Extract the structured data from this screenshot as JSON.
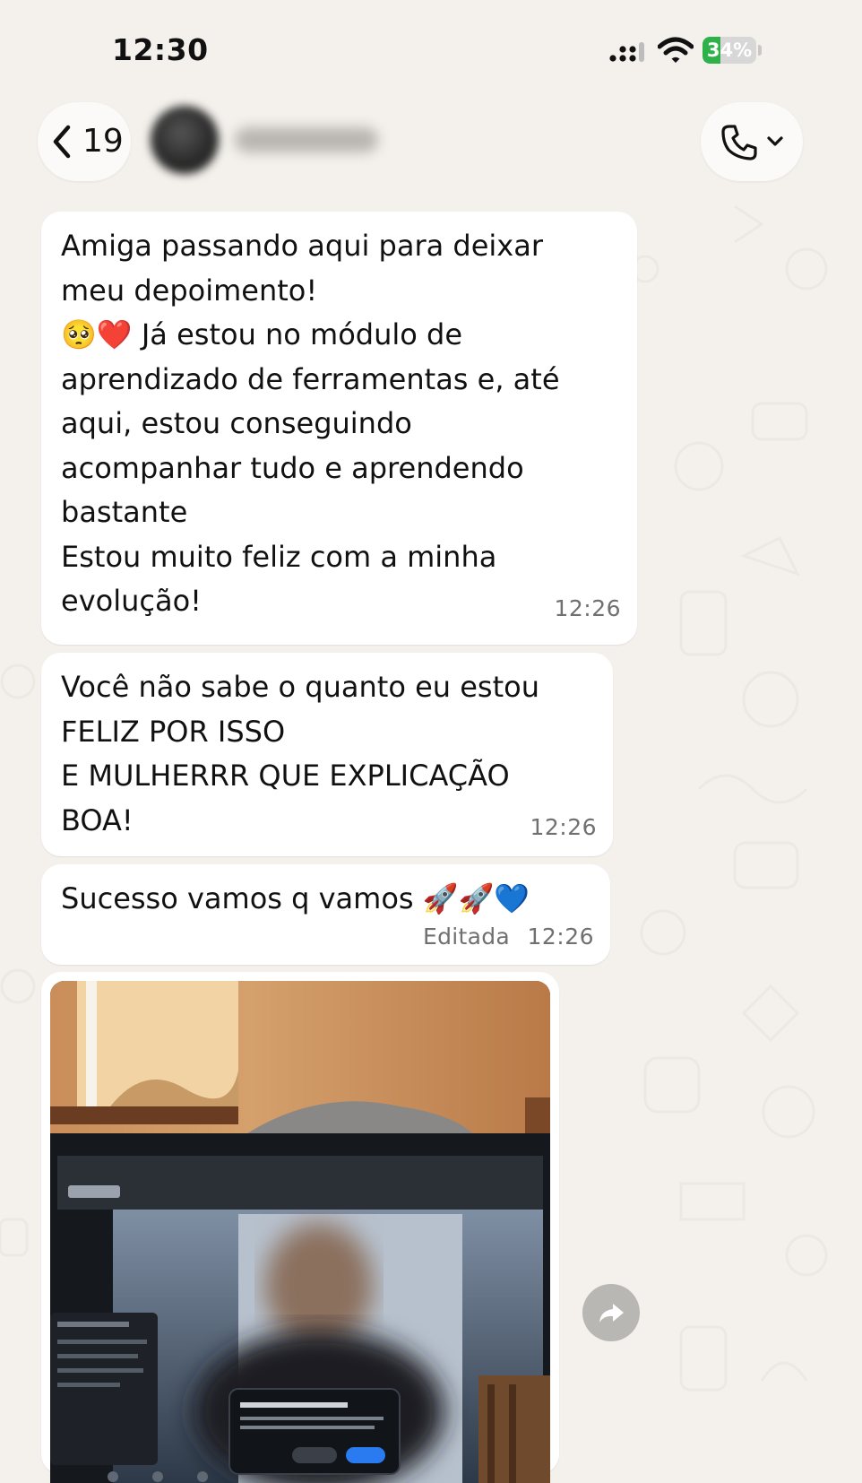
{
  "status_bar": {
    "time": "12:30",
    "battery": "34%",
    "battery_level": 0.34,
    "battery_color": "#2fb14a"
  },
  "header": {
    "back_count": "19",
    "call_icon": "phone-icon"
  },
  "messages": [
    {
      "type": "text",
      "lines": [
        "Amiga passando aqui para deixar",
        "meu depoimento!",
        "🥺❤️ Já estou no módulo de",
        "aprendizado de ferramentas e, até",
        "aqui, estou conseguindo",
        "acompanhar tudo e aprendendo",
        "bastante",
        "Estou muito feliz com a minha",
        "evolução!"
      ],
      "emoji_prefix": "",
      "time": "12:26"
    },
    {
      "type": "text",
      "lines": [
        "Você não sabe o quanto eu estou",
        "FELIZ POR ISSO",
        "E MULHERRR QUE EXPLICAÇÃO",
        "BOA!"
      ],
      "time": "12:26"
    },
    {
      "type": "text",
      "text": "Sucesso vamos q vamos",
      "emojis": "🚀🚀💙",
      "edited": "Editada",
      "time": "12:26"
    },
    {
      "type": "image",
      "description_icon": "forward-icon"
    }
  ],
  "colors": {
    "background": "#f4f1ec",
    "bubble": "#ffffff",
    "meta_text": "#707070"
  }
}
